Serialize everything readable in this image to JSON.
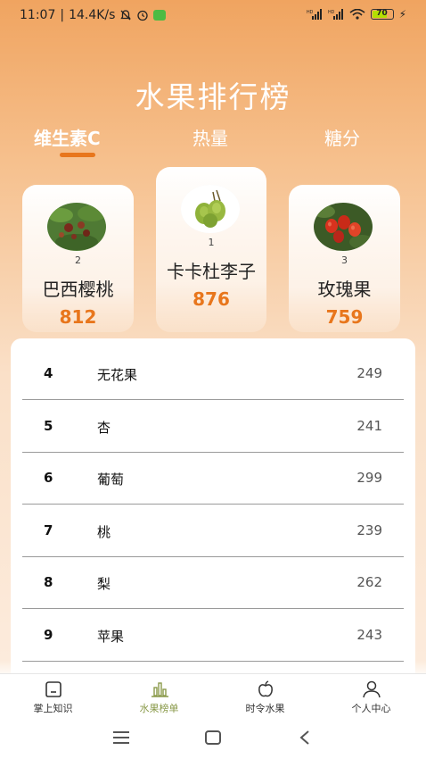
{
  "status_bar": {
    "time": "11:07",
    "speed": "14.4K/s",
    "battery": "70"
  },
  "page_title": "水果排行榜",
  "tabs": [
    {
      "label": "维生素C",
      "active": true
    },
    {
      "label": "热量",
      "active": false
    },
    {
      "label": "糖分",
      "active": false
    }
  ],
  "podium": {
    "first": {
      "rank": "1",
      "name": "卡卡杜李子",
      "score": "876"
    },
    "second": {
      "rank": "2",
      "name": "巴西樱桃",
      "score": "812"
    },
    "third": {
      "rank": "3",
      "name": "玫瑰果",
      "score": "759"
    }
  },
  "ranking": [
    {
      "rank": "4",
      "name": "无花果",
      "score": "249"
    },
    {
      "rank": "5",
      "name": "杏",
      "score": "241"
    },
    {
      "rank": "6",
      "name": "葡萄",
      "score": "299"
    },
    {
      "rank": "7",
      "name": "桃",
      "score": "239"
    },
    {
      "rank": "8",
      "name": "梨",
      "score": "262"
    },
    {
      "rank": "9",
      "name": "苹果",
      "score": "243"
    }
  ],
  "bottom_nav": [
    {
      "label": "掌上知识",
      "icon": "home-icon",
      "active": false
    },
    {
      "label": "水果榜单",
      "icon": "chart-icon",
      "active": true
    },
    {
      "label": "时令水果",
      "icon": "apple-icon",
      "active": false
    },
    {
      "label": "个人中心",
      "icon": "user-icon",
      "active": false
    }
  ],
  "colors": {
    "accent": "#e8761c",
    "header_top": "#f0a460",
    "nav_active": "#8a9a4a"
  }
}
